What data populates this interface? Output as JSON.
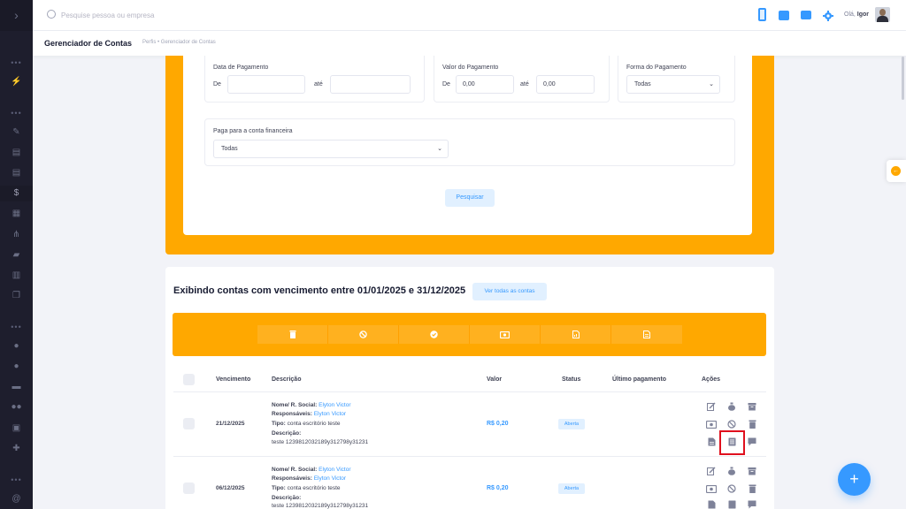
{
  "sidebar": {
    "toggle_label": "›",
    "dots": "•••"
  },
  "topbar": {
    "search_placeholder": "Pesquise pessoa ou empresa",
    "greeting": "Olá,",
    "user_name": "Igor"
  },
  "subheader": {
    "title": "Gerenciador de Contas",
    "breadcrumb": "Perfis  •  Gerenciador de Contas"
  },
  "filters": {
    "payment_date_label": "Data de Pagamento",
    "from_label": "De",
    "to_label": "até",
    "payment_value_label": "Valor do Pagamento",
    "value_from": "0,00",
    "value_to": "0,00",
    "payment_method_label": "Forma do Pagamento",
    "payment_method_selected": "Todas",
    "account_label": "Paga para a conta financeira",
    "account_selected": "Todas",
    "search_button": "Pesquisar"
  },
  "accounts": {
    "title": "Exibindo contas com vencimento entre 01/01/2025 e 31/12/2025",
    "see_all_button": "Ver todas as contas",
    "columns": [
      "Vencimento",
      "Descrição",
      "Valor",
      "Status",
      "Último pagamento",
      "Ações"
    ],
    "rows": [
      {
        "due": "21/12/2025",
        "name_label": "Nome/ R. Social:",
        "name": "Elyton Victor",
        "resp_label": "Responsáveis:",
        "resp": "Elyton Victor",
        "type_label": "Tipo:",
        "type": "conta escritório teste",
        "desc_label": "Descrição:",
        "desc": "teste 1239812032189y312798y31231",
        "value": "R$ 0,20",
        "status": "Aberta"
      },
      {
        "due": "06/12/2025",
        "name_label": "Nome/ R. Social:",
        "name": "Elyton Victor",
        "resp_label": "Responsáveis:",
        "resp": "Elyton Victor",
        "type_label": "Tipo:",
        "type": "conta escritório teste",
        "desc_label": "Descrição:",
        "desc": "teste 1239812032189y312798y31231",
        "value": "R$ 0,20",
        "status": "Aberta"
      }
    ]
  },
  "fab_label": "+",
  "colors": {
    "orange": "#ffa800",
    "blue": "#3699ff",
    "sidebar": "#1e1e2d",
    "highlight": "#e0101e"
  }
}
